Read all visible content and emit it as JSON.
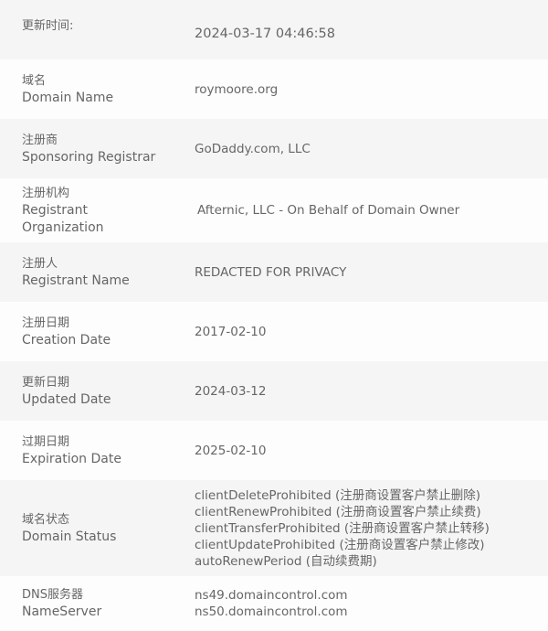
{
  "rows": [
    {
      "cn": "更新时间:",
      "en": "",
      "values": [
        "2024-03-17 04:46:58"
      ]
    },
    {
      "cn": "域名",
      "en": "Domain Name",
      "values": [
        "roymoore.org"
      ]
    },
    {
      "cn": "注册商",
      "en": "Sponsoring Registrar",
      "values": [
        "GoDaddy.com, LLC"
      ]
    },
    {
      "cn": "注册机构",
      "en": "Registrant Organization",
      "values": [
        "Afternic, LLC - On Behalf of Domain Owner"
      ]
    },
    {
      "cn": "注册人",
      "en": "Registrant Name",
      "values": [
        "REDACTED FOR PRIVACY"
      ]
    },
    {
      "cn": "注册日期",
      "en": "Creation Date",
      "values": [
        "2017-02-10"
      ]
    },
    {
      "cn": "更新日期",
      "en": "Updated Date",
      "values": [
        "2024-03-12"
      ]
    },
    {
      "cn": "过期日期",
      "en": "Expiration Date",
      "values": [
        "2025-02-10"
      ]
    },
    {
      "cn": "域名状态",
      "en": "Domain Status",
      "values": [
        "clientDeleteProhibited (注册商设置客户禁止删除)",
        "clientRenewProhibited (注册商设置客户禁止续费)",
        "clientTransferProhibited (注册商设置客户禁止转移)",
        "clientUpdateProhibited (注册商设置客户禁止修改)",
        "autoRenewPeriod (自动续费期)"
      ]
    },
    {
      "cn": "DNS服务器",
      "en": "NameServer",
      "values": [
        "ns49.domaincontrol.com",
        "ns50.domaincontrol.com"
      ]
    }
  ]
}
